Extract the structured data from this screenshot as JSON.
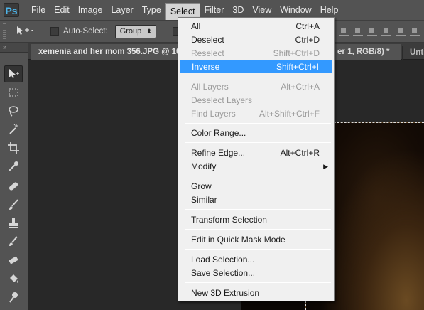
{
  "app": {
    "logo": "Ps"
  },
  "menubar": [
    {
      "label": "File"
    },
    {
      "label": "Edit"
    },
    {
      "label": "Image"
    },
    {
      "label": "Layer"
    },
    {
      "label": "Type"
    },
    {
      "label": "Select"
    },
    {
      "label": "Filter"
    },
    {
      "label": "3D"
    },
    {
      "label": "View"
    },
    {
      "label": "Window"
    },
    {
      "label": "Help"
    }
  ],
  "options": {
    "tool_icon": "move-icon",
    "auto_select_label": "Auto-Select:",
    "auto_select_value": "Group"
  },
  "tabs": {
    "active": "xemenia and her mom 356.JPG @ 100%",
    "active_suffix": "er 1, RGB/8) *",
    "close": "×",
    "other": "Unti"
  },
  "select_menu": {
    "items": [
      {
        "label": "All",
        "shortcut": "Ctrl+A"
      },
      {
        "label": "Deselect",
        "shortcut": "Ctrl+D"
      },
      {
        "label": "Reselect",
        "shortcut": "Shift+Ctrl+D"
      },
      {
        "label": "Inverse",
        "shortcut": "Shift+Ctrl+I"
      },
      {
        "label": "All Layers",
        "shortcut": "Alt+Ctrl+A"
      },
      {
        "label": "Deselect Layers",
        "shortcut": ""
      },
      {
        "label": "Find Layers",
        "shortcut": "Alt+Shift+Ctrl+F"
      },
      {
        "label": "Color Range...",
        "shortcut": ""
      },
      {
        "label": "Refine Edge...",
        "shortcut": "Alt+Ctrl+R"
      },
      {
        "label": "Modify",
        "shortcut": ""
      },
      {
        "label": "Grow",
        "shortcut": ""
      },
      {
        "label": "Similar",
        "shortcut": ""
      },
      {
        "label": "Transform Selection",
        "shortcut": ""
      },
      {
        "label": "Edit in Quick Mask Mode",
        "shortcut": ""
      },
      {
        "label": "Load Selection...",
        "shortcut": ""
      },
      {
        "label": "Save Selection...",
        "shortcut": ""
      },
      {
        "label": "New 3D Extrusion",
        "shortcut": ""
      }
    ]
  },
  "toolbar": {
    "collapse": "»",
    "tools": [
      "move-icon",
      "marquee-icon",
      "lasso-icon",
      "magic-wand-icon",
      "crop-icon",
      "eyedropper-icon",
      "healing-brush-icon",
      "brush-icon",
      "clone-stamp-icon",
      "history-brush-icon",
      "eraser-icon",
      "paint-bucket-icon",
      "smudge-icon"
    ]
  },
  "colors": {
    "highlight": "#3399ff",
    "chrome": "#535353",
    "canvas": "#282828"
  }
}
